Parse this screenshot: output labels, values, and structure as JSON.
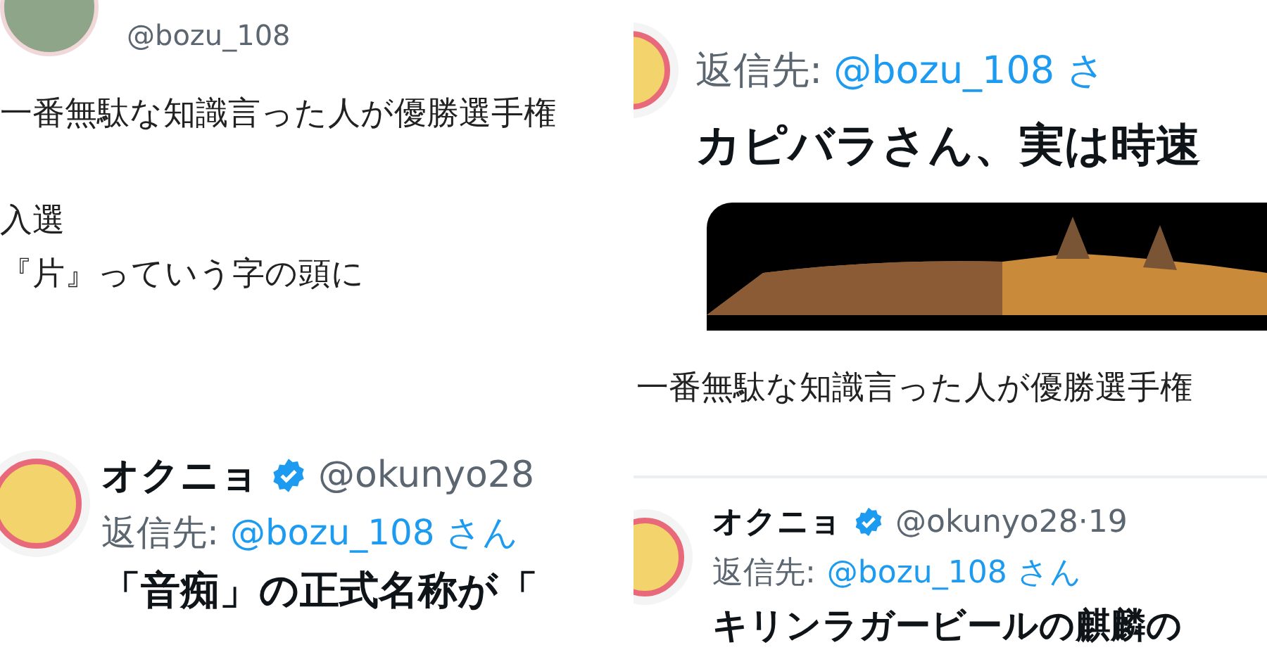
{
  "top_left": {
    "handle": "@bozu_108",
    "paragraphs": [
      [
        "一番無駄な知識言った人が優勝選手権"
      ],
      [
        "入選",
        "『片』っていう字の頭に"
      ]
    ]
  },
  "top_right": {
    "reply_label": "返信先:",
    "reply_to": "@bozu_108 さ",
    "body": "カピバラさん、実は時速"
  },
  "bottom_left": {
    "name": "オクニョ",
    "verified": true,
    "handle": "@okunyo28",
    "reply_label": "返信先:",
    "reply_to": "@bozu_108 さん",
    "body": "「音痴」の正式名称が「"
  },
  "middle_right": {
    "text": "一番無駄な知識言った人が優勝選手権"
  },
  "bottom_right": {
    "name": "オクニョ",
    "verified": true,
    "handle": "@okunyo28·19",
    "reply_label": "返信先:",
    "reply_to": "@bozu_108 さん",
    "body": "キリンラガービールの麒麟の"
  }
}
